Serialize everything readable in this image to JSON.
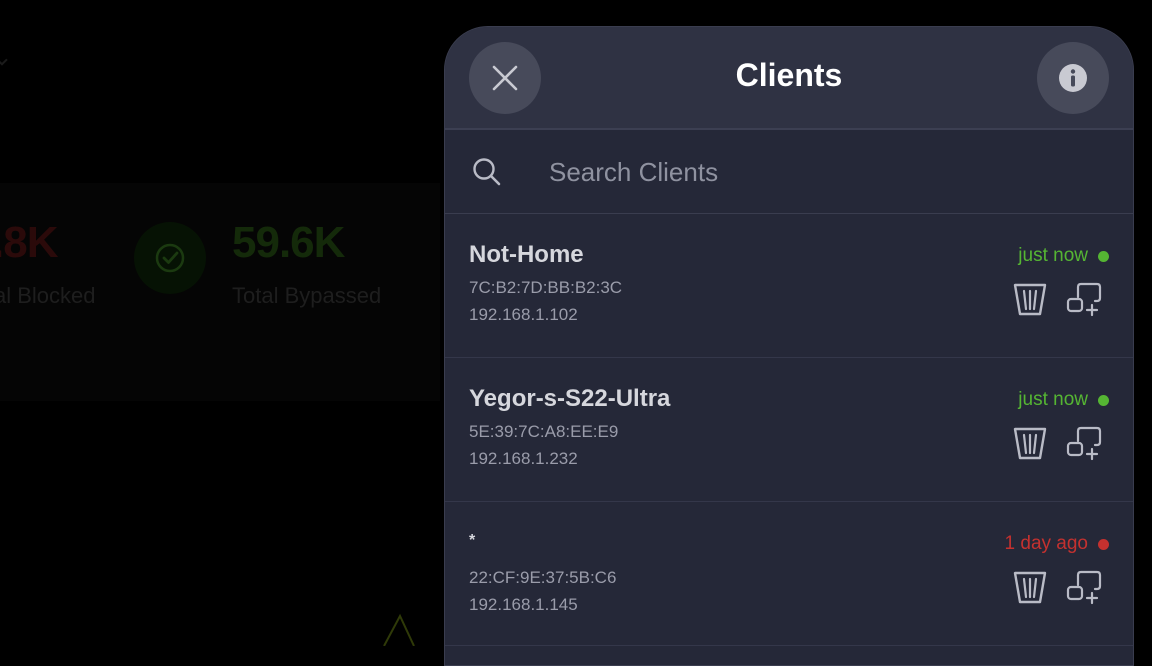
{
  "background": {
    "stats": [
      {
        "value": ".8K",
        "label": "al Blocked",
        "color": "#2b0a0a"
      },
      {
        "value": "59.6K",
        "label": "Total Bypassed",
        "color": "#142a0a"
      }
    ]
  },
  "modal": {
    "title": "Clients",
    "close_icon": "close-icon",
    "info_icon": "info-icon",
    "search": {
      "placeholder": "Search Clients",
      "value": ""
    },
    "clients": [
      {
        "name": "Not-Home",
        "mac": "7C:B2:7D:BB:B2:3C",
        "ip": "192.168.1.102",
        "last_seen": "just now",
        "status_color": "#55b533"
      },
      {
        "name": "Yegor-s-S22-Ultra",
        "mac": "5E:39:7C:A8:EE:E9",
        "ip": "192.168.1.232",
        "last_seen": "just now",
        "status_color": "#55b533"
      },
      {
        "name": "*",
        "mac": "22:CF:9E:37:5B:C6",
        "ip": "192.168.1.145",
        "last_seen": "1 day ago",
        "status_color": "#c4312f"
      }
    ]
  }
}
